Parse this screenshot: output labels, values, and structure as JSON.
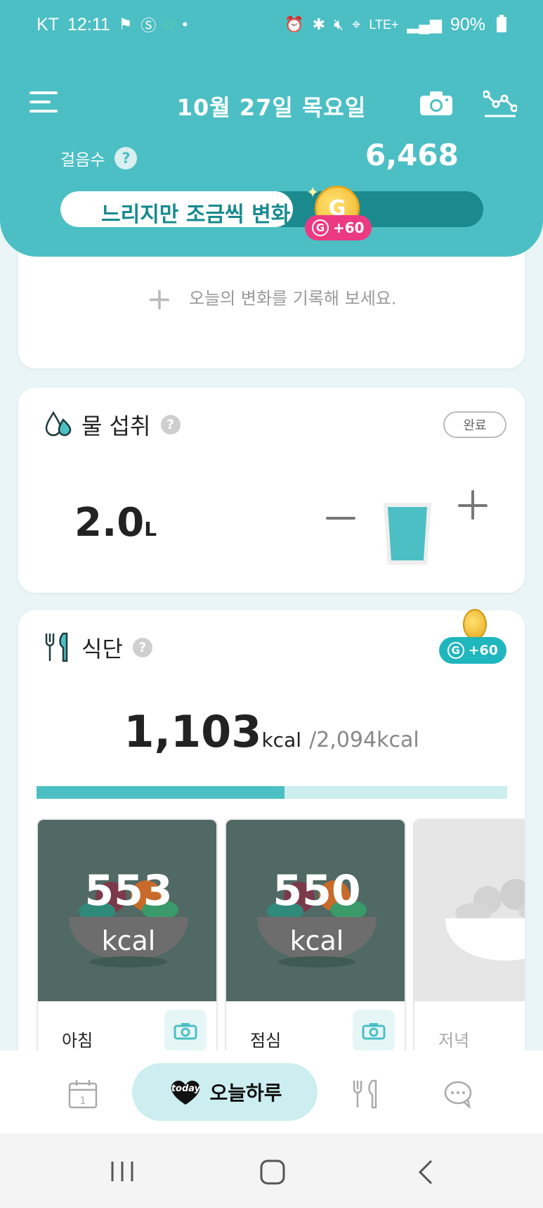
{
  "status_bar": {
    "carrier": "KT",
    "time": "12:11",
    "network": "LTE+",
    "battery": "90%"
  },
  "header": {
    "date": "10월 27일 목요일",
    "steps_label": "걸음수",
    "steps_help": "?",
    "steps_value": "6,468",
    "goal_text": "느리지만 조금씩 변화",
    "goal_progress": 0.55,
    "coin_glyph": "G",
    "reward_badge": "+60"
  },
  "diary": {
    "prompt": "오늘의 변화를 기록해 보세요.",
    "plus": "+"
  },
  "water": {
    "title": "물 섭취",
    "help": "?",
    "done_label": "완료",
    "amount": "2.0",
    "unit": "L"
  },
  "meal": {
    "title": "식단",
    "help": "?",
    "reward_badge": "+60",
    "eaten_kcal": "1,103",
    "kcal_unit": "kcal",
    "goal_kcal": "/2,094kcal",
    "progress": 0.527,
    "cards": [
      {
        "label": "아침",
        "kcal": "553",
        "unit": "kcal",
        "state": "photo"
      },
      {
        "label": "점심",
        "kcal": "550",
        "unit": "kcal",
        "state": "photo"
      },
      {
        "label": "저녁",
        "kcal": "",
        "unit": "",
        "state": "empty"
      }
    ]
  },
  "bottom_nav": {
    "today_badge": "today",
    "today_label": "오늘하루",
    "calendar_day": "1"
  },
  "colors": {
    "primary": "#4cbfc4",
    "dark_teal": "#1b8a8e",
    "pink": "#ec3a82",
    "photo_bg": "#516965"
  }
}
